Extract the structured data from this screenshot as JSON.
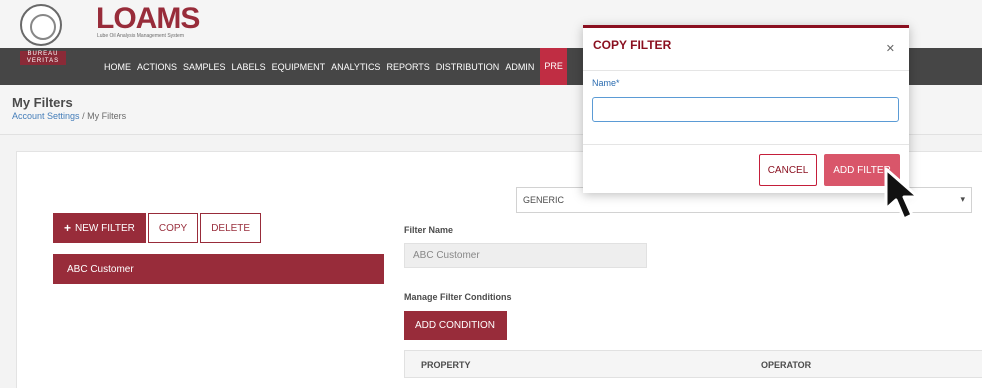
{
  "header": {
    "brand": "LOAMS",
    "brand_sub": "Lube Oil Analysis Management System",
    "badge": "BUREAU VERITAS"
  },
  "nav": {
    "items": [
      {
        "label": "HOME"
      },
      {
        "label": "ACTIONS"
      },
      {
        "label": "SAMPLES"
      },
      {
        "label": "LABELS"
      },
      {
        "label": "EQUIPMENT"
      },
      {
        "label": "ANALYTICS"
      },
      {
        "label": "REPORTS"
      },
      {
        "label": "DISTRIBUTION"
      },
      {
        "label": "ADMIN"
      },
      {
        "label": "PRE"
      }
    ]
  },
  "page": {
    "title": "My Filters",
    "breadcrumb_link": "Account Settings",
    "breadcrumb_sep": "/",
    "breadcrumb_current": "My Filters"
  },
  "toolbar": {
    "new_filter": "NEW FILTER",
    "copy": "COPY",
    "delete": "DELETE"
  },
  "filters": [
    {
      "label": "ABC Customer"
    }
  ],
  "editor": {
    "type_select": "GENERIC",
    "filter_name_label": "Filter Name",
    "filter_name_value": "ABC Customer",
    "conditions_label": "Manage Filter Conditions",
    "add_condition": "ADD CONDITION",
    "columns": [
      "PROPERTY",
      "OPERATOR"
    ]
  },
  "modal": {
    "title": "COPY FILTER",
    "name_label": "Name*",
    "name_value": "",
    "cancel": "CANCEL",
    "add_filter": "ADD FILTER"
  },
  "colors": {
    "brand": "#8a0f1f",
    "accent": "#d9566a",
    "nav_bg": "#2d2d2d"
  }
}
